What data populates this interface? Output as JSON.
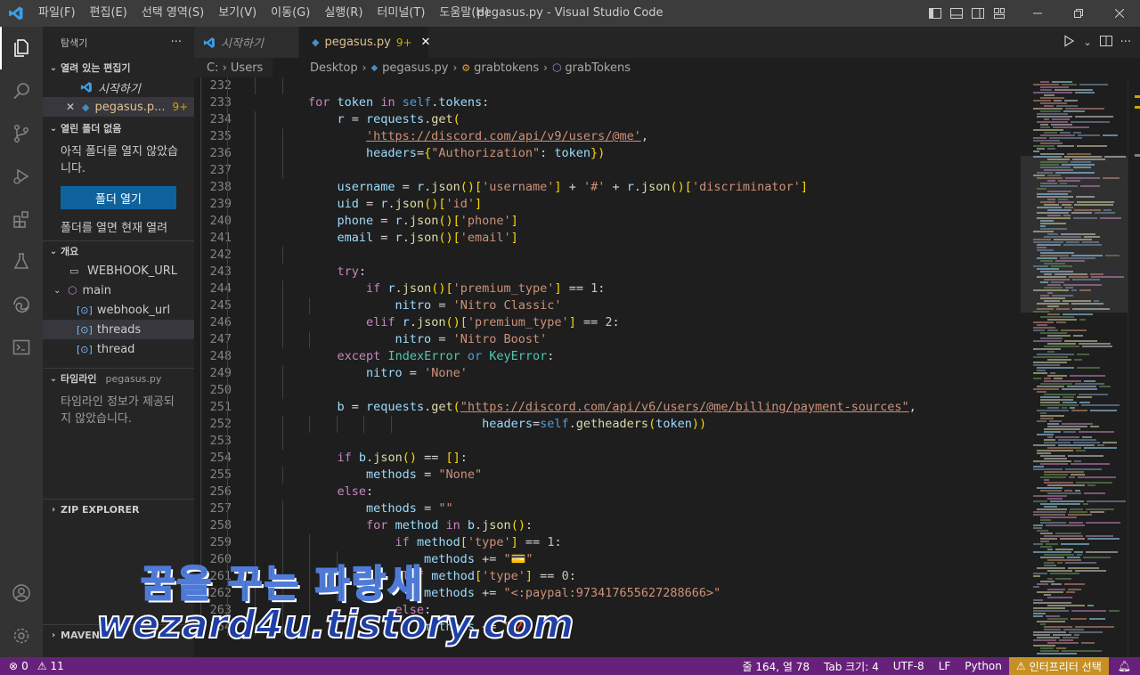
{
  "titlebar": {
    "menu": [
      "파일(F)",
      "편집(E)",
      "선택 영역(S)",
      "보기(V)",
      "이동(G)",
      "실행(R)",
      "터미널(T)",
      "도움말(H)"
    ],
    "window_title": "pegasus.py - Visual Studio Code"
  },
  "sidebar": {
    "title": "탐색기",
    "more": "···",
    "open_editors": {
      "header": "열려 있는 편집기",
      "items": [
        {
          "label": "시작하기"
        },
        {
          "label": "pegasus.p...",
          "badge": "9+"
        }
      ]
    },
    "no_folder": {
      "header": "열린 폴더 없음",
      "message": "아직 폴더를 열지 않았습니다.",
      "button": "폴더 열기",
      "hint": "폴더를 열면 현재 열려"
    },
    "outline": {
      "header": "개요",
      "items": [
        {
          "label": "WEBHOOK_URL"
        },
        {
          "label": "main"
        },
        {
          "label": "webhook_url"
        },
        {
          "label": "threads"
        },
        {
          "label": "thread"
        }
      ]
    },
    "timeline": {
      "header": "타임라인",
      "file": "pegasus.py",
      "message": "타임라인 정보가 제공되지 않았습니다."
    },
    "zip_explorer": {
      "header": "ZIP EXPLORER"
    },
    "maven": {
      "header": "MAVEN"
    }
  },
  "tabs": [
    {
      "label": "시작하기"
    },
    {
      "label": "pegasus.py",
      "badge": "9+"
    }
  ],
  "breadcrumbs": {
    "left": "C: › Users",
    "items": [
      "Desktop",
      "pegasus.py",
      "grabtokens",
      "grabTokens"
    ]
  },
  "line_numbers": [
    "232",
    "233",
    "234",
    "235",
    "236",
    "237",
    "238",
    "239",
    "240",
    "241",
    "242",
    "243",
    "244",
    "245",
    "246",
    "247",
    "248",
    "249",
    "250",
    "251",
    "252",
    "253",
    "254",
    "255",
    "256",
    "257",
    "258",
    "259",
    "260",
    "261",
    "262",
    "263",
    "264"
  ],
  "statusbar": {
    "errors": "0",
    "warnings": "11",
    "position": "줄 164, 열 78",
    "tab_size": "Tab 크기: 4",
    "encoding": "UTF-8",
    "eol": "LF",
    "language": "Python",
    "interpreter": "인터프리터 선택"
  },
  "watermark": {
    "line1": "꿈을 꾸는 파랑새",
    "line2": "wezard4u.tistory.com"
  },
  "colors": {
    "statusbar": "#68217a",
    "accent_button": "#0e639c",
    "warning": "#cca700"
  }
}
